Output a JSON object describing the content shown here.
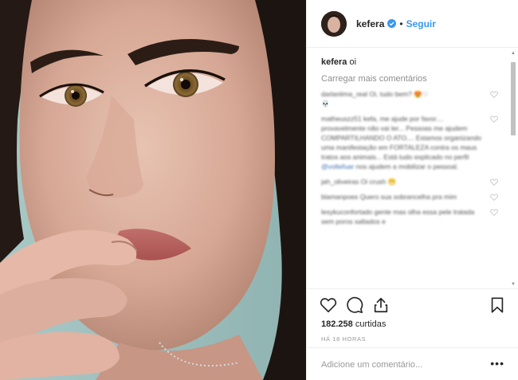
{
  "post": {
    "image_alt": "Close-up selfie of a woman with brown eyes and dark hair",
    "author": {
      "username": "kefera",
      "verified": true,
      "follow_label": "Seguir",
      "separator": "•"
    },
    "caption": {
      "username": "kefera",
      "text": "oi"
    },
    "load_more_label": "Carregar mais comentários",
    "comments": [
      {
        "user": "darlanlima_real",
        "text": "Oi, tudo bem? 😍♡",
        "extra": "💀"
      },
      {
        "user": "matheuszz51",
        "text": "kefa, me ajude por favor.... provavelmente não vai ler... Pessoas me ajudem COMPARTILHANDO O ATO.... Estamos organizando uma manifestação em FORTALEZA contra os maus tratos aos animais... Está tudo explicado no perfil",
        "link": "@voltefuar",
        "tail": "nos ajudem a mobilizar o pessoal."
      },
      {
        "user": "jah_oliveiras",
        "text": "Oi crush 😁"
      },
      {
        "user": "blamanpoes",
        "text": "Quero sua sobrancelha pra mim"
      },
      {
        "user": "lesykuconfortado",
        "text": "gente mas olha essa pele tratada sem poros saltados e"
      }
    ],
    "likes": {
      "count": "182.258",
      "unit": "curtidas"
    },
    "timestamp": "HÁ 18 HORAS",
    "comment_input": {
      "placeholder": "Adicione um comentário...",
      "value": ""
    },
    "more_label": "•••",
    "icons": {
      "like": "heart-icon",
      "comment": "comment-bubble-icon",
      "share": "share-icon",
      "save": "bookmark-icon",
      "verified": "verified-badge-icon"
    },
    "colors": {
      "link_blue": "#3897f0",
      "verified_blue": "#3897f0",
      "border": "#efefef",
      "text": "#262626",
      "muted": "#8e8e8e"
    }
  }
}
